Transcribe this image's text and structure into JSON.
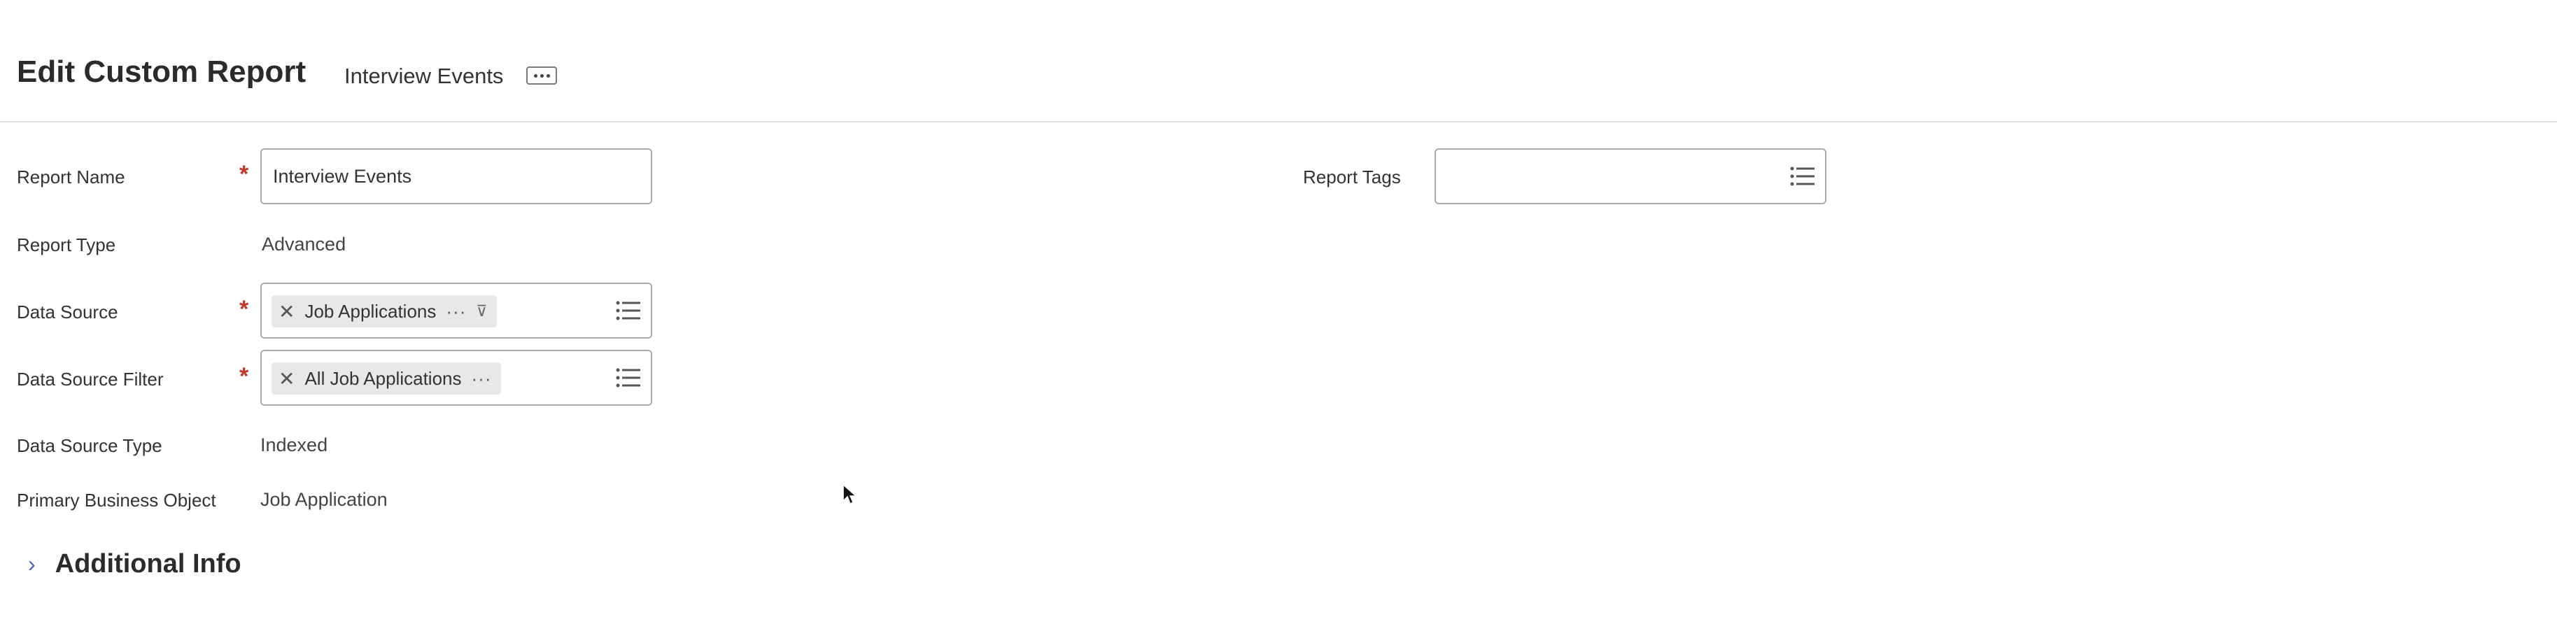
{
  "header": {
    "title": "Edit Custom Report",
    "subtitle": "Interview Events"
  },
  "form": {
    "report_name": {
      "label": "Report Name",
      "value": "Interview Events"
    },
    "report_type": {
      "label": "Report Type",
      "value": "Advanced"
    },
    "data_source": {
      "label": "Data Source",
      "chip": "Job Applications"
    },
    "data_source_filter": {
      "label": "Data Source Filter",
      "chip": "All Job Applications"
    },
    "data_source_type": {
      "label": "Data Source Type",
      "value": "Indexed"
    },
    "primary_business_object": {
      "label": "Primary Business Object",
      "value": "Job Application"
    },
    "report_tags": {
      "label": "Report Tags",
      "value": ""
    },
    "required_marker": "*"
  },
  "sections": {
    "additional_info": "Additional Info"
  },
  "icons": {
    "more": "ellipsis-icon",
    "list": "list-icon",
    "remove": "close-icon",
    "pin": "pin-icon",
    "expand": "chevron-right-icon"
  },
  "colors": {
    "required": "#c0392b",
    "chevron": "#4a63b8",
    "chip_bg": "#e8e8e8"
  }
}
